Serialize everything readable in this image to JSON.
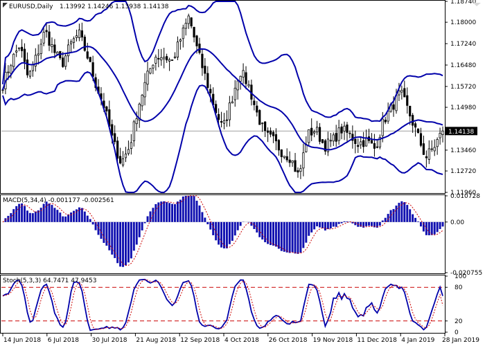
{
  "header": {
    "symbol": "EURUSD,Daily",
    "ohlc": "1.13992 1.14246 1.13938 1.14138"
  },
  "colors": {
    "bg": "#ffffff",
    "bull": "#000000",
    "bear": "#000000",
    "band": "#0000aa",
    "hist": "#1010b0",
    "signal": "#cc0000",
    "pricebox": "#000000",
    "priceline": "#a0a0a0",
    "frame": "#000000"
  },
  "chart_data": [
    {
      "type": "candlestick",
      "title": "EURUSD,Daily",
      "current_price_label": "1.14138",
      "y_ticks": [
        "1.18740",
        "1.18000",
        "1.17240",
        "1.16480",
        "1.15720",
        "1.14980",
        "1.14138",
        "1.13460",
        "1.12720",
        "1.11960"
      ],
      "ylim": [
        1.1196,
        1.1874
      ],
      "x_ticks": [
        "14 Jun 2018",
        "6 Jul 2018",
        "30 Jul 2018",
        "21 Aug 2018",
        "12 Sep 2018",
        "4 Oct 2018",
        "26 Oct 2018",
        "19 Nov 2018",
        "11 Dec 2018",
        "4 Jan 2019",
        "28 Jan 2019"
      ],
      "indicator": "Bollinger Bands",
      "close_anchors": [
        1.158,
        1.166,
        1.172,
        1.16,
        1.168,
        1.177,
        1.17,
        1.165,
        1.172,
        1.176,
        1.168,
        1.158,
        1.15,
        1.138,
        1.13,
        1.136,
        1.15,
        1.16,
        1.168,
        1.168,
        1.166,
        1.174,
        1.182,
        1.17,
        1.16,
        1.15,
        1.142,
        1.152,
        1.163,
        1.158,
        1.148,
        1.14,
        1.138,
        1.134,
        1.132,
        1.125,
        1.14,
        1.142,
        1.136,
        1.138,
        1.142,
        1.14,
        1.137,
        1.138,
        1.135,
        1.145,
        1.15,
        1.155,
        1.148,
        1.14,
        1.132,
        1.136,
        1.1414
      ]
    },
    {
      "type": "bar",
      "title": "MACD(5,34,4) -0.001177 -0.002561",
      "label": "MACD(5,34,4)",
      "values_text": "-0.001177 -0.002561",
      "y_ticks": [
        "0.010728",
        "0.00",
        "-0.020755"
      ],
      "ylim": [
        -0.020755,
        0.010728
      ],
      "series": [
        {
          "name": "MACD",
          "kind": "histogram"
        },
        {
          "name": "Signal",
          "kind": "dotted line"
        }
      ]
    },
    {
      "type": "line",
      "title": "Stoch(5,3,3) 64.7471 47.9453",
      "label": "Stoch(5,3,3)",
      "values_text": "64.7471 47.9453",
      "y_ticks": [
        "100",
        "80",
        "20",
        "0"
      ],
      "ylim": [
        0,
        100
      ],
      "levels": [
        80,
        20
      ],
      "series": [
        {
          "name": "%K",
          "kind": "solid line"
        },
        {
          "name": "%D",
          "kind": "dashed line"
        }
      ]
    }
  ]
}
